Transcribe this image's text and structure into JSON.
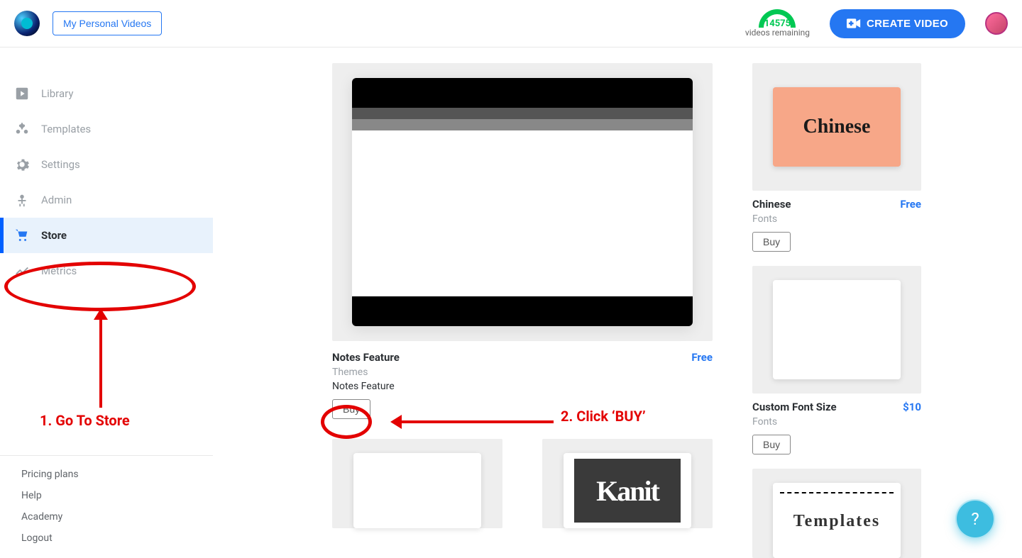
{
  "header": {
    "personal_videos_label": "My Personal Videos",
    "videos_remaining_count": "14575",
    "videos_remaining_label": "videos remaining",
    "create_video_label": "CREATE VIDEO"
  },
  "sidebar": {
    "items": [
      {
        "label": "Library"
      },
      {
        "label": "Templates"
      },
      {
        "label": "Settings"
      },
      {
        "label": "Admin"
      },
      {
        "label": "Store"
      },
      {
        "label": "Metrics"
      }
    ],
    "bottom_links": [
      "Pricing plans",
      "Help",
      "Academy",
      "Logout"
    ]
  },
  "annotations": {
    "step1": "1. Go To Store",
    "step2": "2. Click ‘BUY’"
  },
  "store": {
    "featured": {
      "title": "Notes Feature",
      "price": "Free",
      "category": "Themes",
      "description": "Notes Feature",
      "buy_label": "Buy"
    },
    "right": [
      {
        "thumb_text": "Chinese",
        "title": "Chinese",
        "price": "Free",
        "category": "Fonts",
        "buy_label": "Buy"
      },
      {
        "title": "Custom Font Size",
        "price": "$10",
        "category": "Fonts",
        "buy_label": "Buy"
      }
    ],
    "bottom": [
      {
        "thumb_text": ""
      },
      {
        "thumb_text": "Kanit"
      },
      {
        "thumb_text": "Templates"
      }
    ]
  },
  "help_fab": "?"
}
